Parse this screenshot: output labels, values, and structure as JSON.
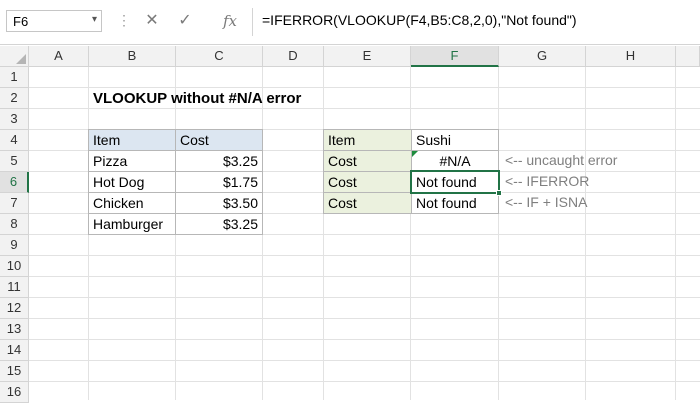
{
  "formula_bar": {
    "name_box": "F6",
    "name_box_caret": "▾",
    "dots": "⋮",
    "cancel_icon": "✕",
    "enter_icon": "✓",
    "fx_label": "fx",
    "formula": "=IFERROR(VLOOKUP(F4,B5:C8,2,0),\"Not found\")"
  },
  "columns": [
    "A",
    "B",
    "C",
    "D",
    "E",
    "F",
    "G",
    "H"
  ],
  "rows": [
    "1",
    "2",
    "3",
    "4",
    "5",
    "6",
    "7",
    "8",
    "9",
    "10",
    "11",
    "12",
    "13",
    "14",
    "15",
    "16"
  ],
  "selected_column": "F",
  "selected_row": "6",
  "title": "VLOOKUP without #N/A error",
  "lookup_table": {
    "headers": [
      "Item",
      "Cost"
    ],
    "rows": [
      {
        "item": "Pizza",
        "cost": "$3.25"
      },
      {
        "item": "Hot Dog",
        "cost": "$1.75"
      },
      {
        "item": "Chicken",
        "cost": "$3.50"
      },
      {
        "item": "Hamburger",
        "cost": "$3.25"
      }
    ]
  },
  "result_table": {
    "item_label": "Item",
    "item_value": "Sushi",
    "rows": [
      {
        "label": "Cost",
        "value": "#N/A",
        "note": "<-- uncaught error"
      },
      {
        "label": "Cost",
        "value": "Not found",
        "note": "<-- IFERROR"
      },
      {
        "label": "Cost",
        "value": "Not found",
        "note": "<-- IF + ISNA"
      }
    ]
  },
  "colors": {
    "header_fill": "#dce6f1",
    "label_fill": "#ebf1de",
    "selection": "#217346"
  }
}
